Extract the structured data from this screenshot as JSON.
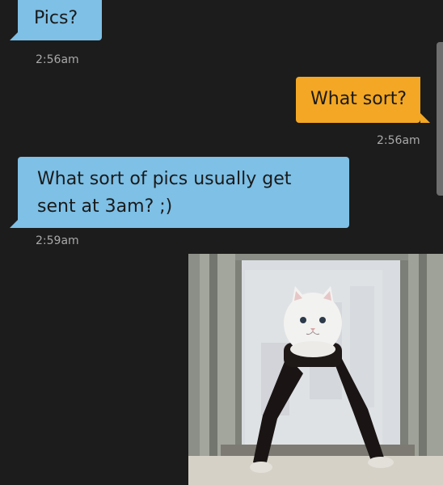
{
  "conversation": {
    "messages": [
      {
        "side": "in",
        "text": "Pics?",
        "time": "2:56am"
      },
      {
        "side": "out",
        "text": "What sort?",
        "time": "2:56am"
      },
      {
        "side": "in",
        "text": "What sort of pics usually get sent at 3am? ;)",
        "time": "2:59am"
      }
    ],
    "photo": {
      "subject": "cat-head-on-legs-photo"
    }
  },
  "colors": {
    "background": "#1c1c1c",
    "incoming_bubble": "#7ec0e6",
    "outgoing_bubble": "#f3a724",
    "timestamp": "#a9a9a9"
  }
}
